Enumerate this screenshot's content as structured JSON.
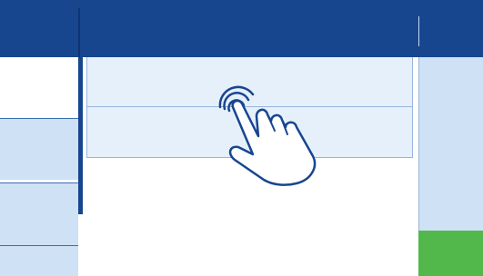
{
  "header": {
    "background": "#17468f"
  },
  "sidebar": {
    "items": [
      {
        "name": "sidebar-item-1",
        "state": "selected"
      },
      {
        "name": "sidebar-item-2",
        "state": "normal"
      },
      {
        "name": "sidebar-item-3",
        "state": "normal"
      },
      {
        "name": "sidebar-item-4",
        "state": "normal"
      }
    ]
  },
  "list": {
    "rows": [
      {
        "name": "list-row-1"
      },
      {
        "name": "list-row-2"
      }
    ]
  },
  "gesture": {
    "icon": "hand-tap-icon",
    "action": "tap"
  },
  "colors": {
    "primary": "#17468f",
    "panel": "#cfe1f4",
    "list_bg": "#e6f0fb",
    "accent_green": "#52b84b"
  }
}
